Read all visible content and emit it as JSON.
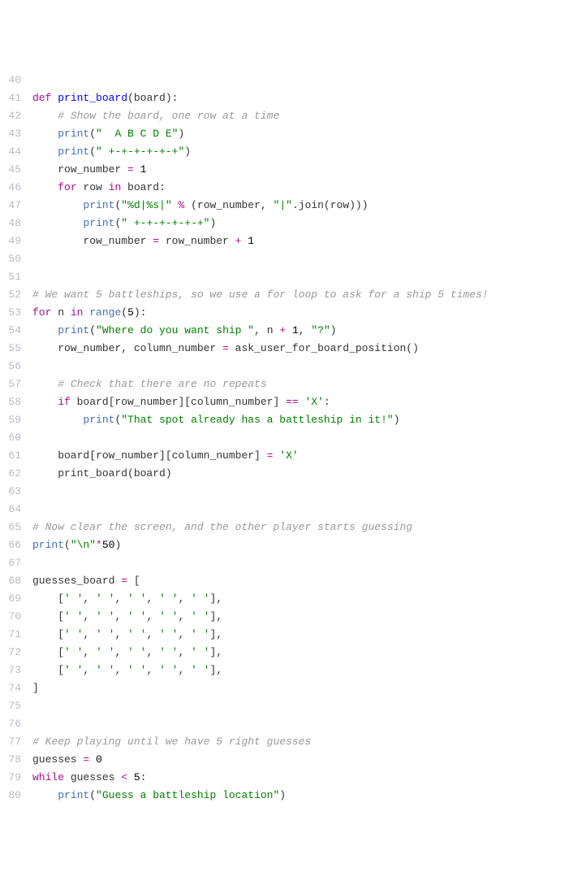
{
  "lines": [
    {
      "num": "40",
      "content": ""
    },
    {
      "num": "41",
      "content": "<span class='kw'>def</span> <span class='def'>print_board</span><span class='paren'>(board):</span>"
    },
    {
      "num": "42",
      "content": "    <span class='com'># Show the board, one row at a time</span>"
    },
    {
      "num": "43",
      "content": "    <span class='fn'>print</span>(<span class='str'>\"  A B C D E\"</span>)"
    },
    {
      "num": "44",
      "content": "    <span class='fn'>print</span>(<span class='str'>\" +-+-+-+-+-+\"</span>)"
    },
    {
      "num": "45",
      "content": "    row_number <span class='op'>=</span> <span class='num'>1</span>"
    },
    {
      "num": "46",
      "content": "    <span class='kw'>for</span> row <span class='kw'>in</span> board:"
    },
    {
      "num": "47",
      "content": "        <span class='fn'>print</span>(<span class='str'>\"%d|%s|\"</span> <span class='op'>%</span> (row_number, <span class='str'>\"|\"</span>.join(row)))"
    },
    {
      "num": "48",
      "content": "        <span class='fn'>print</span>(<span class='str'>\" +-+-+-+-+-+\"</span>)"
    },
    {
      "num": "49",
      "content": "        row_number <span class='op'>=</span> row_number <span class='op'>+</span> <span class='num'>1</span>"
    },
    {
      "num": "50",
      "content": ""
    },
    {
      "num": "51",
      "content": ""
    },
    {
      "num": "52",
      "content": "<span class='com'># We want 5 battleships, so we use a for loop to ask for a ship 5 times!</span>"
    },
    {
      "num": "53",
      "content": "<span class='kw'>for</span> n <span class='kw'>in</span> <span class='fn'>range</span>(<span class='num'>5</span>):"
    },
    {
      "num": "54",
      "content": "    <span class='fn'>print</span>(<span class='str'>\"Where do you want ship \"</span>, n <span class='op'>+</span> <span class='num'>1</span>, <span class='str'>\"?\"</span>)"
    },
    {
      "num": "55",
      "content": "    row_number, column_number <span class='op'>=</span> ask_user_for_board_position()"
    },
    {
      "num": "56",
      "content": ""
    },
    {
      "num": "57",
      "content": "    <span class='com'># Check that there are no repeats</span>"
    },
    {
      "num": "58",
      "content": "    <span class='kw'>if</span> board[row_number][column_number] <span class='op'>==</span> <span class='str'>'X'</span>:"
    },
    {
      "num": "59",
      "content": "        <span class='fn'>print</span>(<span class='str'>\"That spot already has a battleship in it!\"</span>)"
    },
    {
      "num": "60",
      "content": ""
    },
    {
      "num": "61",
      "content": "    board[row_number][column_number] <span class='op'>=</span> <span class='str'>'X'</span>"
    },
    {
      "num": "62",
      "content": "    print_board(board)"
    },
    {
      "num": "63",
      "content": ""
    },
    {
      "num": "64",
      "content": ""
    },
    {
      "num": "65",
      "content": "<span class='com'># Now clear the screen, and the other player starts guessing</span>"
    },
    {
      "num": "66",
      "content": "<span class='fn'>print</span>(<span class='str'>\"\\n\"</span><span class='op'>*</span><span class='num'>50</span>)"
    },
    {
      "num": "67",
      "content": ""
    },
    {
      "num": "68",
      "content": "guesses_board <span class='op'>=</span> ["
    },
    {
      "num": "69",
      "content": "    [<span class='str'>' '</span>, <span class='str'>' '</span>, <span class='str'>' '</span>, <span class='str'>' '</span>, <span class='str'>' '</span>],"
    },
    {
      "num": "70",
      "content": "    [<span class='str'>' '</span>, <span class='str'>' '</span>, <span class='str'>' '</span>, <span class='str'>' '</span>, <span class='str'>' '</span>],"
    },
    {
      "num": "71",
      "content": "    [<span class='str'>' '</span>, <span class='str'>' '</span>, <span class='str'>' '</span>, <span class='str'>' '</span>, <span class='str'>' '</span>],"
    },
    {
      "num": "72",
      "content": "    [<span class='str'>' '</span>, <span class='str'>' '</span>, <span class='str'>' '</span>, <span class='str'>' '</span>, <span class='str'>' '</span>],"
    },
    {
      "num": "73",
      "content": "    [<span class='str'>' '</span>, <span class='str'>' '</span>, <span class='str'>' '</span>, <span class='str'>' '</span>, <span class='str'>' '</span>],"
    },
    {
      "num": "74",
      "content": "]"
    },
    {
      "num": "75",
      "content": ""
    },
    {
      "num": "76",
      "content": ""
    },
    {
      "num": "77",
      "content": "<span class='com'># Keep playing until we have 5 right guesses</span>"
    },
    {
      "num": "78",
      "content": "guesses <span class='op'>=</span> <span class='num'>0</span>"
    },
    {
      "num": "79",
      "content": "<span class='kw'>while</span> guesses <span class='op'>&lt;</span> <span class='num'>5</span>:"
    },
    {
      "num": "80",
      "content": "    <span class='fn'>print</span>(<span class='str'>\"Guess a battleship location\"</span>)"
    }
  ]
}
